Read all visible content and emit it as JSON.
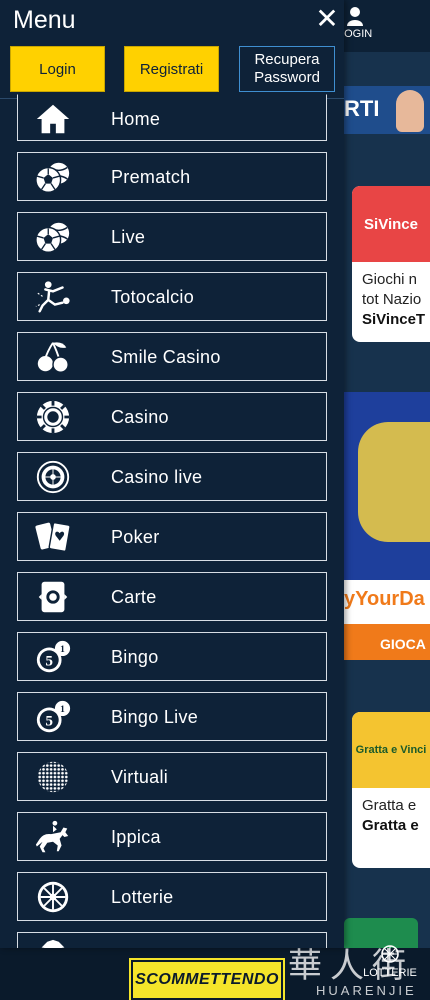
{
  "drawer": {
    "title": "Menu",
    "close_icon": "close-icon",
    "buttons": {
      "login": "Login",
      "register": "Registrati",
      "recover": "Recupera\nPassword"
    },
    "items": [
      {
        "label": "Home",
        "icon": "home-icon"
      },
      {
        "label": "Prematch",
        "icon": "sports-balls-icon"
      },
      {
        "label": "Live",
        "icon": "sports-balls-icon"
      },
      {
        "label": "Totocalcio",
        "icon": "football-player-icon"
      },
      {
        "label": "Smile Casino",
        "icon": "cherries-icon"
      },
      {
        "label": "Casino",
        "icon": "casino-chip-icon"
      },
      {
        "label": "Casino live",
        "icon": "roulette-icon"
      },
      {
        "label": "Poker",
        "icon": "playing-cards-icon"
      },
      {
        "label": "Carte",
        "icon": "card-icon"
      },
      {
        "label": "Bingo",
        "icon": "bingo-ball-icon"
      },
      {
        "label": "Bingo Live",
        "icon": "bingo-ball-icon"
      },
      {
        "label": "Virtuali",
        "icon": "virtual-ball-icon"
      },
      {
        "label": "Ippica",
        "icon": "horse-racing-icon"
      },
      {
        "label": "Lotterie",
        "icon": "lottery-wheel-icon"
      }
    ],
    "bingo_badge": "1",
    "bingo_number": "5"
  },
  "background": {
    "header_login": "LOGIN",
    "banner1_text": "RTI",
    "card1": {
      "brand": "SiVince",
      "line1": "Giochi n",
      "line2": "tot Nazio",
      "line3": "SiVinceT"
    },
    "play": {
      "strip": "yYourDa",
      "cta": "GIOCA"
    },
    "card3": {
      "brand": "Gratta e Vinci",
      "line1": "Gratta e",
      "line2": "Gratta e"
    },
    "lotterie": "LOTTERIE"
  },
  "footer": {
    "brand": "SCOMMETTENDO",
    "watermark_cn": "華人街",
    "watermark_lat": "HUARENJIE"
  },
  "colors": {
    "drawer_bg": "#0e2238",
    "accent_yellow": "#ffd100",
    "outline_blue": "#3f8fd1",
    "item_border": "#d7dde4"
  }
}
